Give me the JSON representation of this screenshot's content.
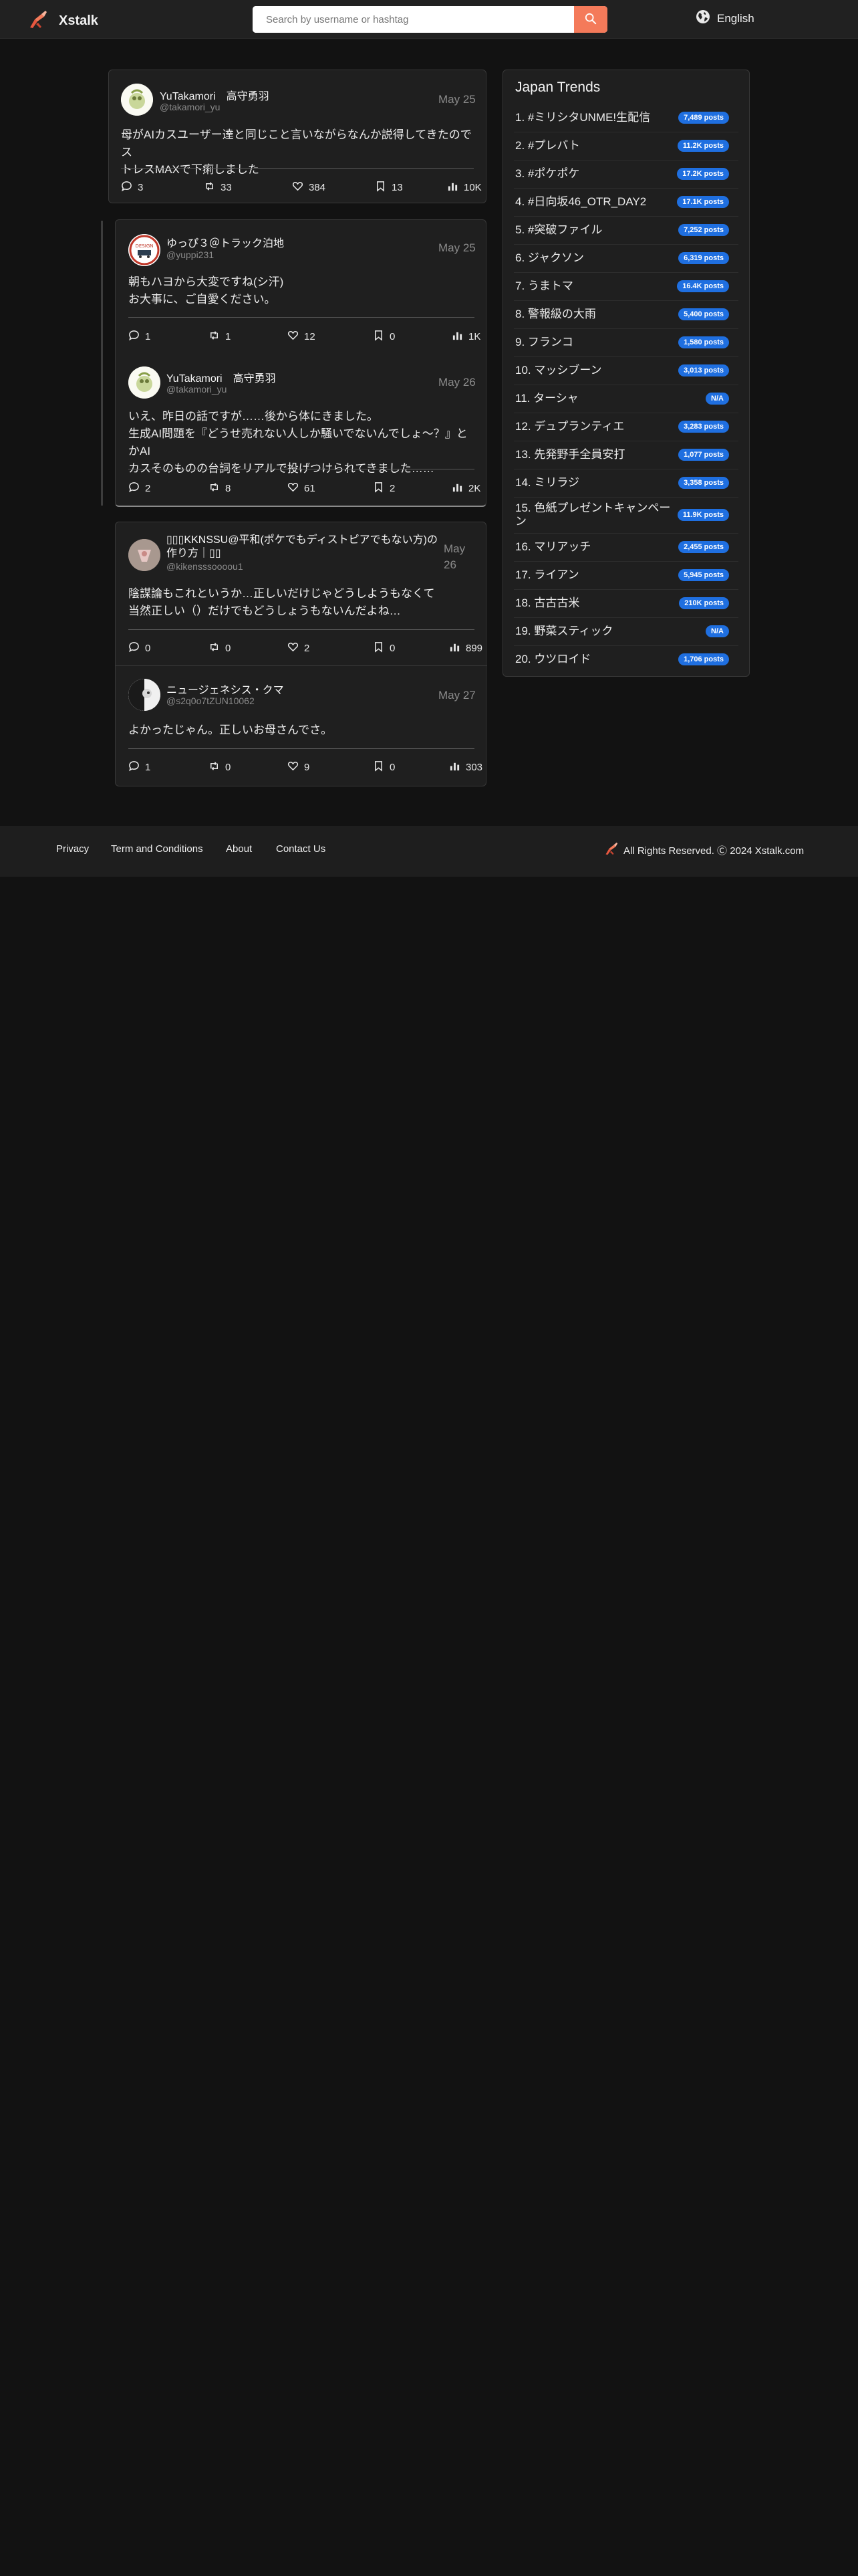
{
  "header": {
    "brand": "Xstalk",
    "search_placeholder": "Search by username or hashtag",
    "language": "English"
  },
  "colors": {
    "accent": "#f47a5a",
    "badge": "#1f6fe0",
    "background": "#121212",
    "card": "#1f1f1f"
  },
  "posts": [
    {
      "display_name": "YuTakamori　高守勇羽",
      "handle": "@takamori_yu",
      "date": "May 25",
      "text": [
        "母がAIカスユーザー達と同じこと言いながらなんか説得してきたのでス",
        "トレスMAXで下痢しました"
      ],
      "comments": "3",
      "reposts": "33",
      "likes": "384",
      "bookmarks": "13",
      "views": "10K"
    },
    {
      "display_name": "ゆっぴ３＠トラック泊地",
      "handle": "@yuppi231",
      "date": "May 25",
      "text": [
        "朝もハヨから大変ですね(シ汗)",
        "お大事に、ご自愛ください。"
      ],
      "comments": "1",
      "reposts": "1",
      "likes": "12",
      "bookmarks": "0",
      "views": "1K"
    },
    {
      "display_name": "YuTakamori　高守勇羽",
      "handle": "@takamori_yu",
      "date": "May 26",
      "text": [
        "いえ、昨日の話ですが……後から体にきました。",
        "生成AI問題を『どうせ売れない人しか騒いでないんでしょ～？』とかAI",
        "カスそのものの台詞をリアルで投げつけられてきました……"
      ],
      "comments": "2",
      "reposts": "8",
      "likes": "61",
      "bookmarks": "2",
      "views": "2K"
    },
    {
      "display_name_lines": [
        "▯▯▯KKNSSU@平和(ポケでもディストピアでもない方)の",
        "作り方｜▯▯"
      ],
      "handle": "@kikensssoooou1",
      "date_lines": [
        "May",
        "26"
      ],
      "text": [
        "陰謀論もこれというか…正しいだけじゃどうしようもなくて",
        "当然正しい（）だけでもどうしょうもないんだよね…"
      ],
      "comments": "0",
      "reposts": "0",
      "likes": "2",
      "bookmarks": "0",
      "views": "899"
    },
    {
      "display_name": "ニュージェネシス・クマ",
      "handle": "@s2q0o7tZUN10062",
      "date": "May 27",
      "text": [
        "よかったじゃん。正しいお母さんでさ。"
      ],
      "comments": "1",
      "reposts": "0",
      "likes": "9",
      "bookmarks": "0",
      "views": "303"
    }
  ],
  "trends": {
    "title": "Japan Trends",
    "items": [
      {
        "name": "1. #ミリシタUNME!生配信",
        "count": "7,489 posts"
      },
      {
        "name": "2. #プレバト",
        "count": "11.2K posts"
      },
      {
        "name": "3. #ポケポケ",
        "count": "17.2K posts"
      },
      {
        "name": "4. #日向坂46_OTR_DAY2",
        "count": "17.1K posts"
      },
      {
        "name": "5. #突破ファイル",
        "count": "7,252 posts"
      },
      {
        "name": "6. ジャクソン",
        "count": "6,319 posts"
      },
      {
        "name": "7. うまトマ",
        "count": "16.4K posts"
      },
      {
        "name": "8. 警報級の大雨",
        "count": "5,400 posts"
      },
      {
        "name": "9. フランコ",
        "count": "1,580 posts"
      },
      {
        "name": "10. マッシブーン",
        "count": "3,013 posts"
      },
      {
        "name": "11. ターシャ",
        "count": "N/A"
      },
      {
        "name": "12. デュプランティエ",
        "count": "3,283 posts"
      },
      {
        "name": "13. 先発野手全員安打",
        "count": "1,077 posts"
      },
      {
        "name": "14. ミリラジ",
        "count": "3,358 posts"
      },
      {
        "name": "15. 色紙プレゼントキャンペーン",
        "count": "11.9K posts"
      },
      {
        "name": "16. マリアッチ",
        "count": "2,455 posts"
      },
      {
        "name": "17. ライアン",
        "count": "5,945 posts"
      },
      {
        "name": "18. 古古古米",
        "count": "210K posts"
      },
      {
        "name": "19. 野菜スティック",
        "count": "N/A"
      },
      {
        "name": "20. ウツロイド",
        "count": "1,706 posts"
      }
    ]
  },
  "footer": {
    "links": [
      "Privacy",
      "Term and Conditions",
      "About",
      "Contact Us"
    ],
    "copyright": "All Rights Reserved. Ⓒ 2024 Xstalk.com"
  }
}
